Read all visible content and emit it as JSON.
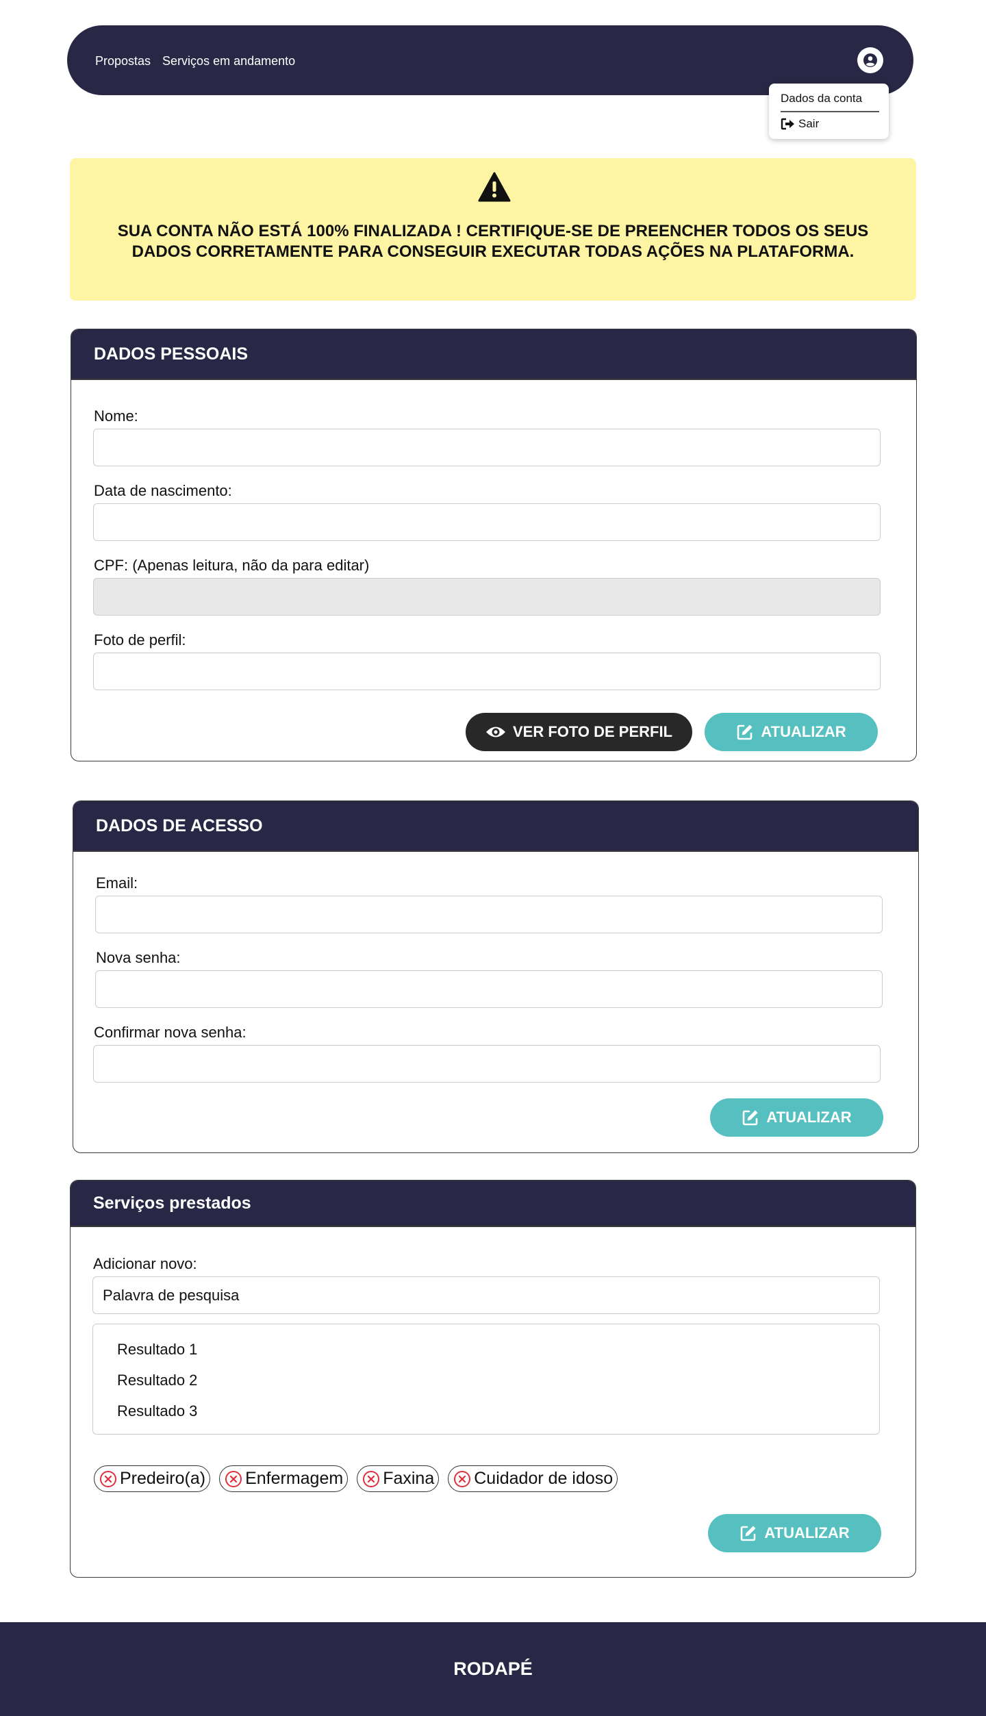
{
  "nav": {
    "links": [
      "Propostas",
      "Serviços em andamento"
    ]
  },
  "account_menu": {
    "items": [
      "Dados da conta",
      "Sair"
    ]
  },
  "warning": {
    "text": "SUA CONTA NÃO ESTÁ 100% FINALIZADA ! CERTIFIQUE-SE DE PREENCHER TODOS OS SEUS DADOS CORRETAMENTE PARA CONSEGUIR EXECUTAR TODAS AÇÕES NA PLATAFORMA."
  },
  "personal": {
    "title": "DADOS PESSOAIS",
    "name_label": "Nome:",
    "name_value": "",
    "birth_label": "Data de nascimento:",
    "birth_value": "",
    "cpf_label": "CPF: (Apenas leitura, não da para editar)",
    "cpf_value": "",
    "photo_label": "Foto de perfil:",
    "photo_value": "",
    "view_photo_button": "VER FOTO DE PERFIL",
    "update_button": "ATUALIZAR"
  },
  "access": {
    "title": "DADOS DE ACESSO",
    "email_label": "Email:",
    "email_value": "",
    "password_label": "Nova senha:",
    "password_value": "",
    "confirm_label": "Confirmar nova senha:",
    "confirm_value": "",
    "update_button": "ATUALIZAR"
  },
  "services": {
    "title": "Serviços prestados",
    "add_label": "Adicionar novo:",
    "search_value": "Palavra de pesquisa",
    "results": [
      "Resultado 1",
      "Resultado 2",
      "Resultado 3"
    ],
    "tags": [
      "Predeiro(a)",
      "Enfermagem",
      "Faxina",
      "Cuidador de idoso"
    ],
    "update_button": "ATUALIZAR"
  },
  "footer": {
    "text": "RODAPÉ"
  },
  "colors": {
    "navy": "#282745",
    "teal": "#56bfbf",
    "warning_bg": "#fdf5a4",
    "dark_button": "#282828",
    "tag_close": "#e0313a"
  }
}
